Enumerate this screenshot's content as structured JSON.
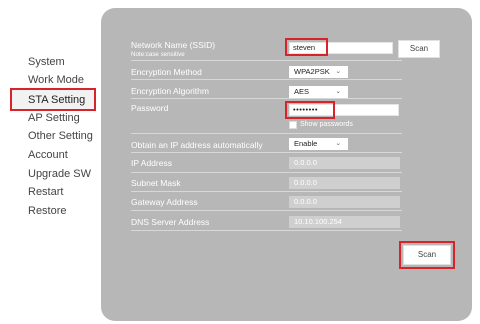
{
  "sidebar": {
    "items": [
      {
        "label": "System"
      },
      {
        "label": "Work Mode"
      },
      {
        "label": "STA Setting"
      },
      {
        "label": "AP Setting"
      },
      {
        "label": "Other Setting"
      },
      {
        "label": "Account"
      },
      {
        "label": "Upgrade SW"
      },
      {
        "label": "Restart"
      },
      {
        "label": "Restore"
      }
    ],
    "active": "STA Setting"
  },
  "form": {
    "ssid": {
      "label": "Network Name (SSID)",
      "note": "Note:case sensitive",
      "value": "steven",
      "scan_label": "Scan"
    },
    "encryption_method": {
      "label": "Encryption Method",
      "value": "WPA2PSK"
    },
    "encryption_algorithm": {
      "label": "Encryption Algorithm",
      "value": "AES"
    },
    "password": {
      "label": "Password",
      "value": "••••••••",
      "show_label": "Show passwords",
      "show_checked": false
    },
    "obtain_ip": {
      "label": "Obtain an IP address automatically",
      "value": "Enable"
    },
    "ip_address": {
      "label": "IP Address",
      "value": "0.0.0.0"
    },
    "subnet_mask": {
      "label": "Subnet Mask",
      "value": "0.0.0.0"
    },
    "gateway": {
      "label": "Gateway Address",
      "value": "0.0.0.0"
    },
    "dns": {
      "label": "DNS Server Address",
      "value": "10.10.100.254"
    },
    "submit_label": "Scan"
  },
  "colors": {
    "panel": "#b7b7b7",
    "highlight": "#d8232a",
    "disabled_field": "#cfcfcf"
  },
  "icons": {
    "select_arrow": "chevron-down-icon"
  }
}
